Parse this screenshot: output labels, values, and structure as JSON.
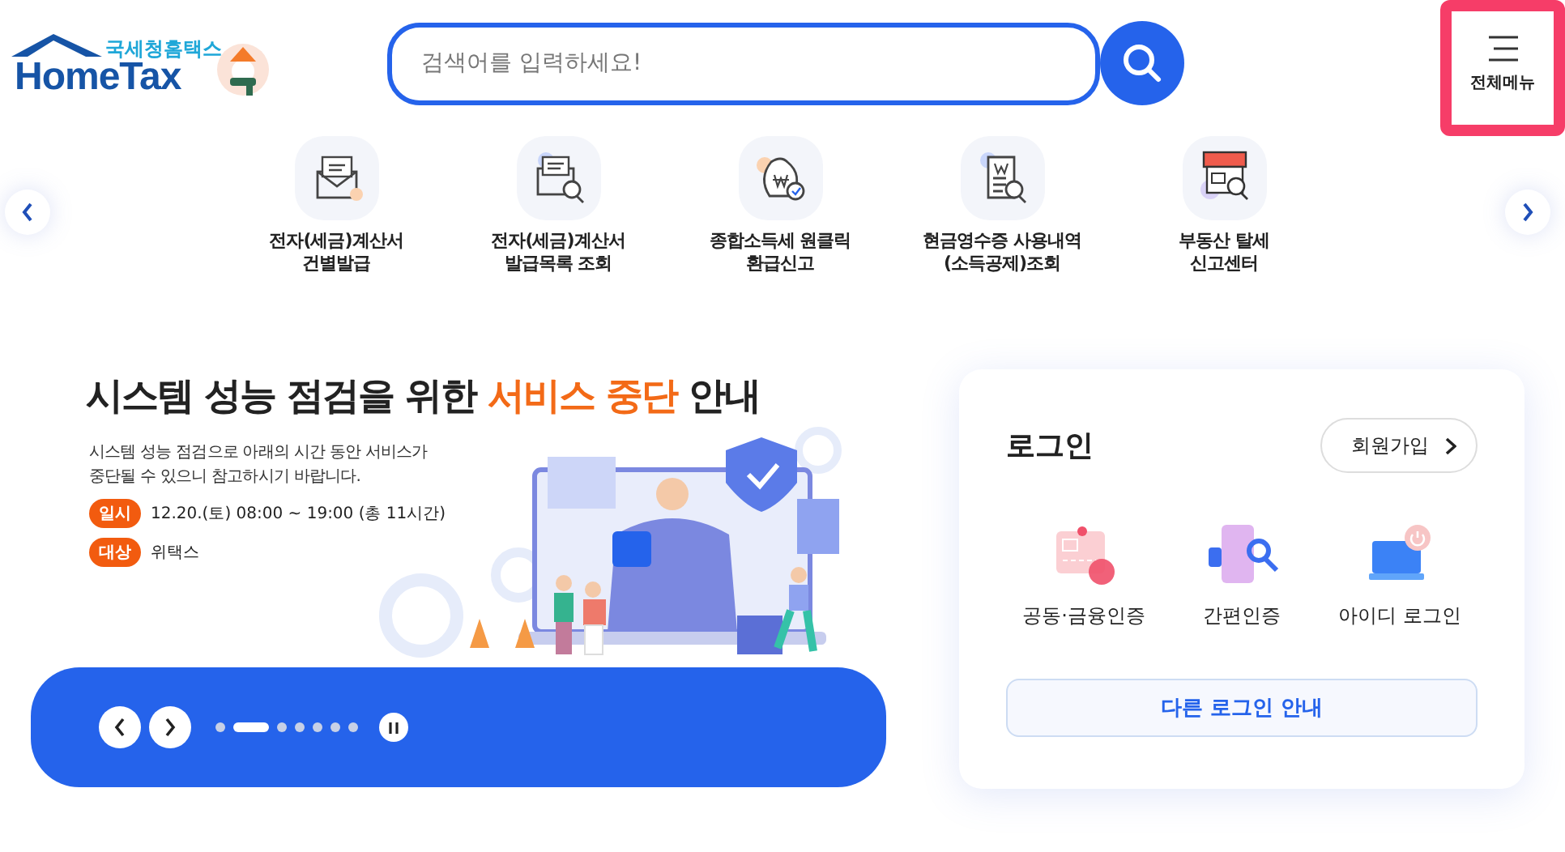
{
  "header": {
    "logo": {
      "subtitle": "국세청홈택스",
      "name": "HomeTax"
    },
    "search": {
      "placeholder": "검색어를 입력하세요!"
    },
    "menu_button": {
      "label": "전체메뉴",
      "focused": true
    }
  },
  "quick_links": [
    {
      "kind": "tax-envelope",
      "label": "전자(세금)계산서\n건별발급"
    },
    {
      "kind": "tax-search",
      "label": "전자(세금)계산서\n발급목록 조회"
    },
    {
      "kind": "money-bag",
      "label": "종합소득세 원클릭\n환급신고"
    },
    {
      "kind": "receipt",
      "label": "현금영수증 사용내역\n(소득공제)조회"
    },
    {
      "kind": "store",
      "label": "부동산 탈세\n신고센터"
    }
  ],
  "banner": {
    "title": "시스템 성능 점검을 위한 **서비스 중단** 안내",
    "description": "시스템 성능 점검으로 아래의 시간 동안 서비스가\n중단될 수 있으니 참고하시기 바랍니다.",
    "details": [
      {
        "tag": "일시",
        "text": "12.20.(토) 08:00 ~ 19:00 (총 11시간)"
      },
      {
        "tag": "대상",
        "text": "위택스"
      }
    ],
    "dots": [
      {
        "selected": false
      },
      {
        "selected": true
      },
      {
        "selected": false
      },
      {
        "selected": false
      },
      {
        "selected": false
      },
      {
        "selected": false
      },
      {
        "selected": false
      }
    ]
  },
  "login": {
    "title": "로그인",
    "signup": "회원가입",
    "options": [
      {
        "kind": "certificate",
        "label": "공동·금융인증"
      },
      {
        "kind": "phone",
        "label": "간편인증"
      },
      {
        "kind": "laptop",
        "label": "아이디 로그인"
      }
    ],
    "other": "다른 로그인 안내"
  }
}
